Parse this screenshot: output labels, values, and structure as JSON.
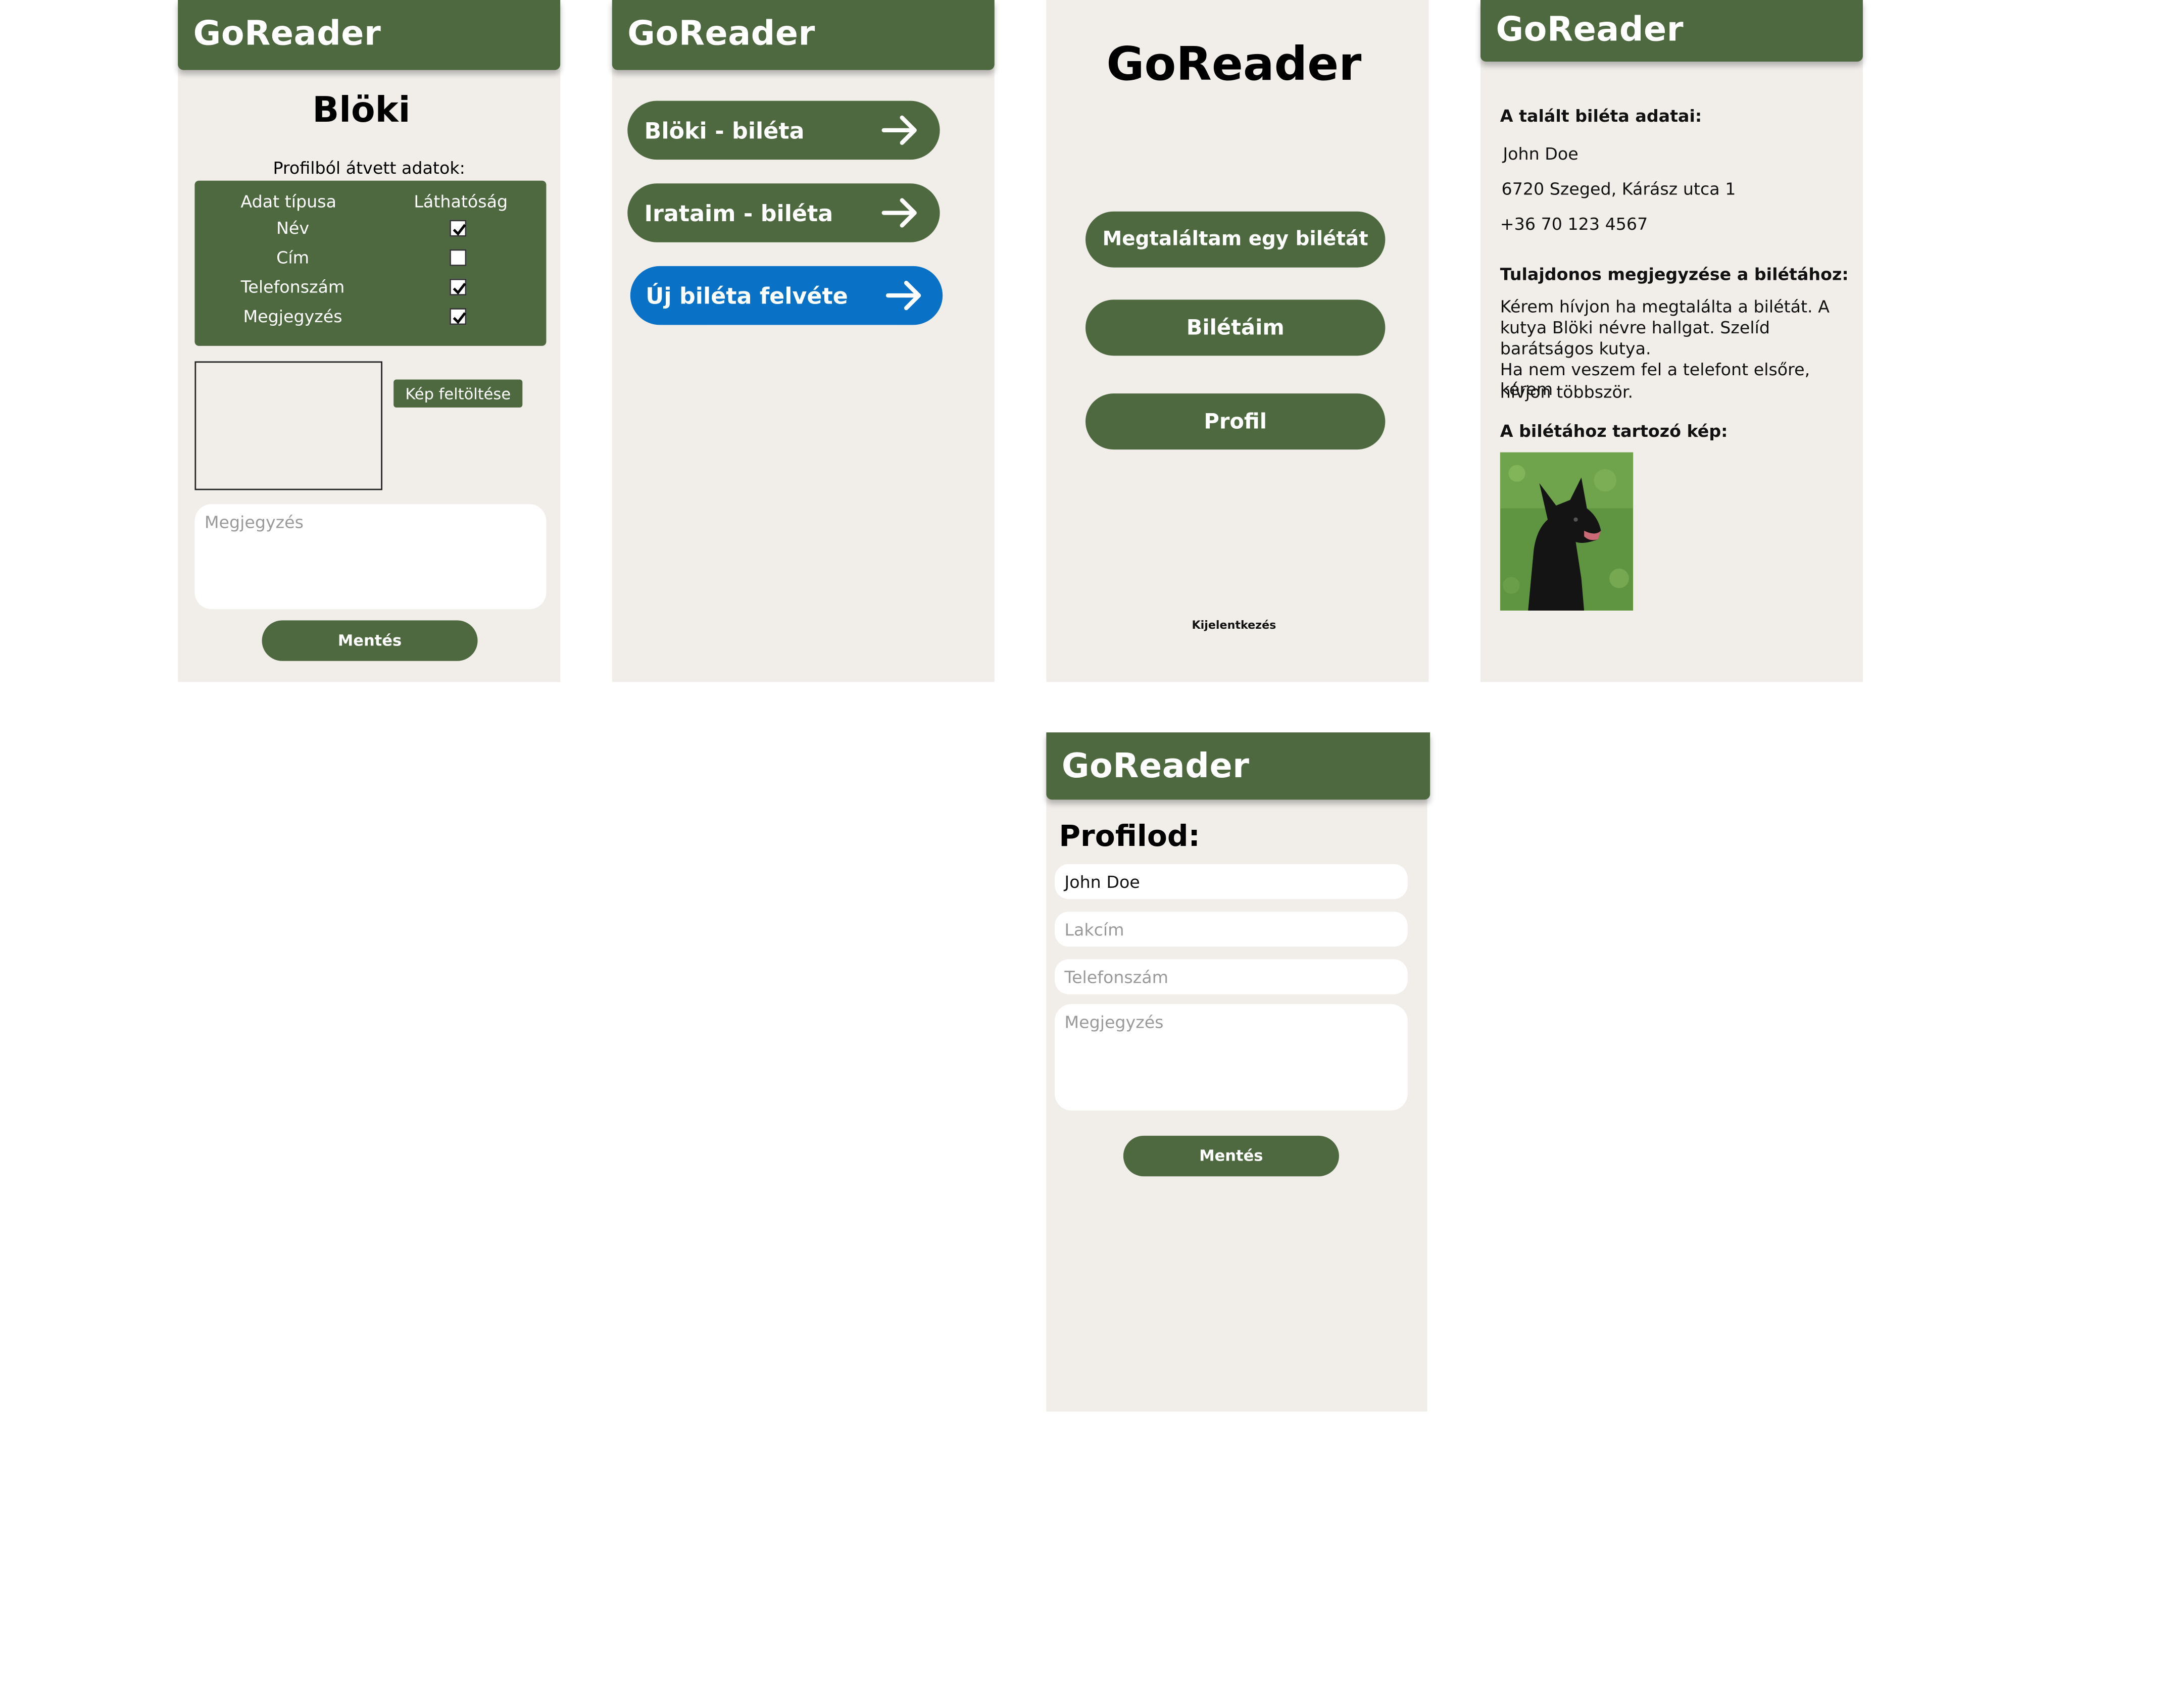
{
  "app_title": "GoReader",
  "colors": {
    "primary_green": "#4e6840",
    "accent_blue": "#0a72c6",
    "background": "#f1eeea"
  },
  "screen_new_tag": {
    "tag_name": "Blöki",
    "profile_data_heading": "Profilból átvett adatok:",
    "table_headers": {
      "type": "Adat típusa",
      "visibility": "Láthatóság"
    },
    "rows": [
      {
        "label": "Név",
        "checked": true
      },
      {
        "label": "Cím",
        "checked": false
      },
      {
        "label": "Telefonszám",
        "checked": true
      },
      {
        "label": "Megjegyzés",
        "checked": true
      }
    ],
    "upload_button": "Kép feltöltése",
    "note_placeholder": "Megjegyzés",
    "save_button": "Mentés"
  },
  "screen_tags_list": {
    "items": [
      {
        "label": "Blöki - biléta",
        "icon": "arrow-right-icon"
      },
      {
        "label": "Irataim - biléta",
        "icon": "arrow-right-icon"
      },
      {
        "label": "Új biléta felvéte",
        "icon": "arrow-right-icon"
      }
    ]
  },
  "screen_home": {
    "found_button": "Megtaláltam egy bilétát",
    "my_tags_button": "Bilétáim",
    "profile_button": "Profil",
    "logout_link": "Kijelentkezés"
  },
  "screen_found": {
    "found_heading": "A talált biléta adatai:",
    "name": "John Doe",
    "address": "6720 Szeged, Kárász utca 1",
    "phone": "+36 70 123 4567",
    "note_heading": "Tulajdonos megjegyzése a bilétához:",
    "note_lines": [
      "Kérem hívjon ha megtalálta a bilétát. A",
      "kutya Blöki névre hallgat. Szelíd",
      "barátságos kutya.",
      "Ha nem veszem fel a telefont elsőre, kérem",
      "hívjon többször."
    ],
    "image_heading": "A bilétához tartozó kép:"
  },
  "screen_profile": {
    "heading": "Profilod:",
    "name_value": "John Doe",
    "address_placeholder": "Lakcím",
    "phone_placeholder": "Telefonszám",
    "note_placeholder": "Megjegyzés",
    "save_button": "Mentés"
  }
}
